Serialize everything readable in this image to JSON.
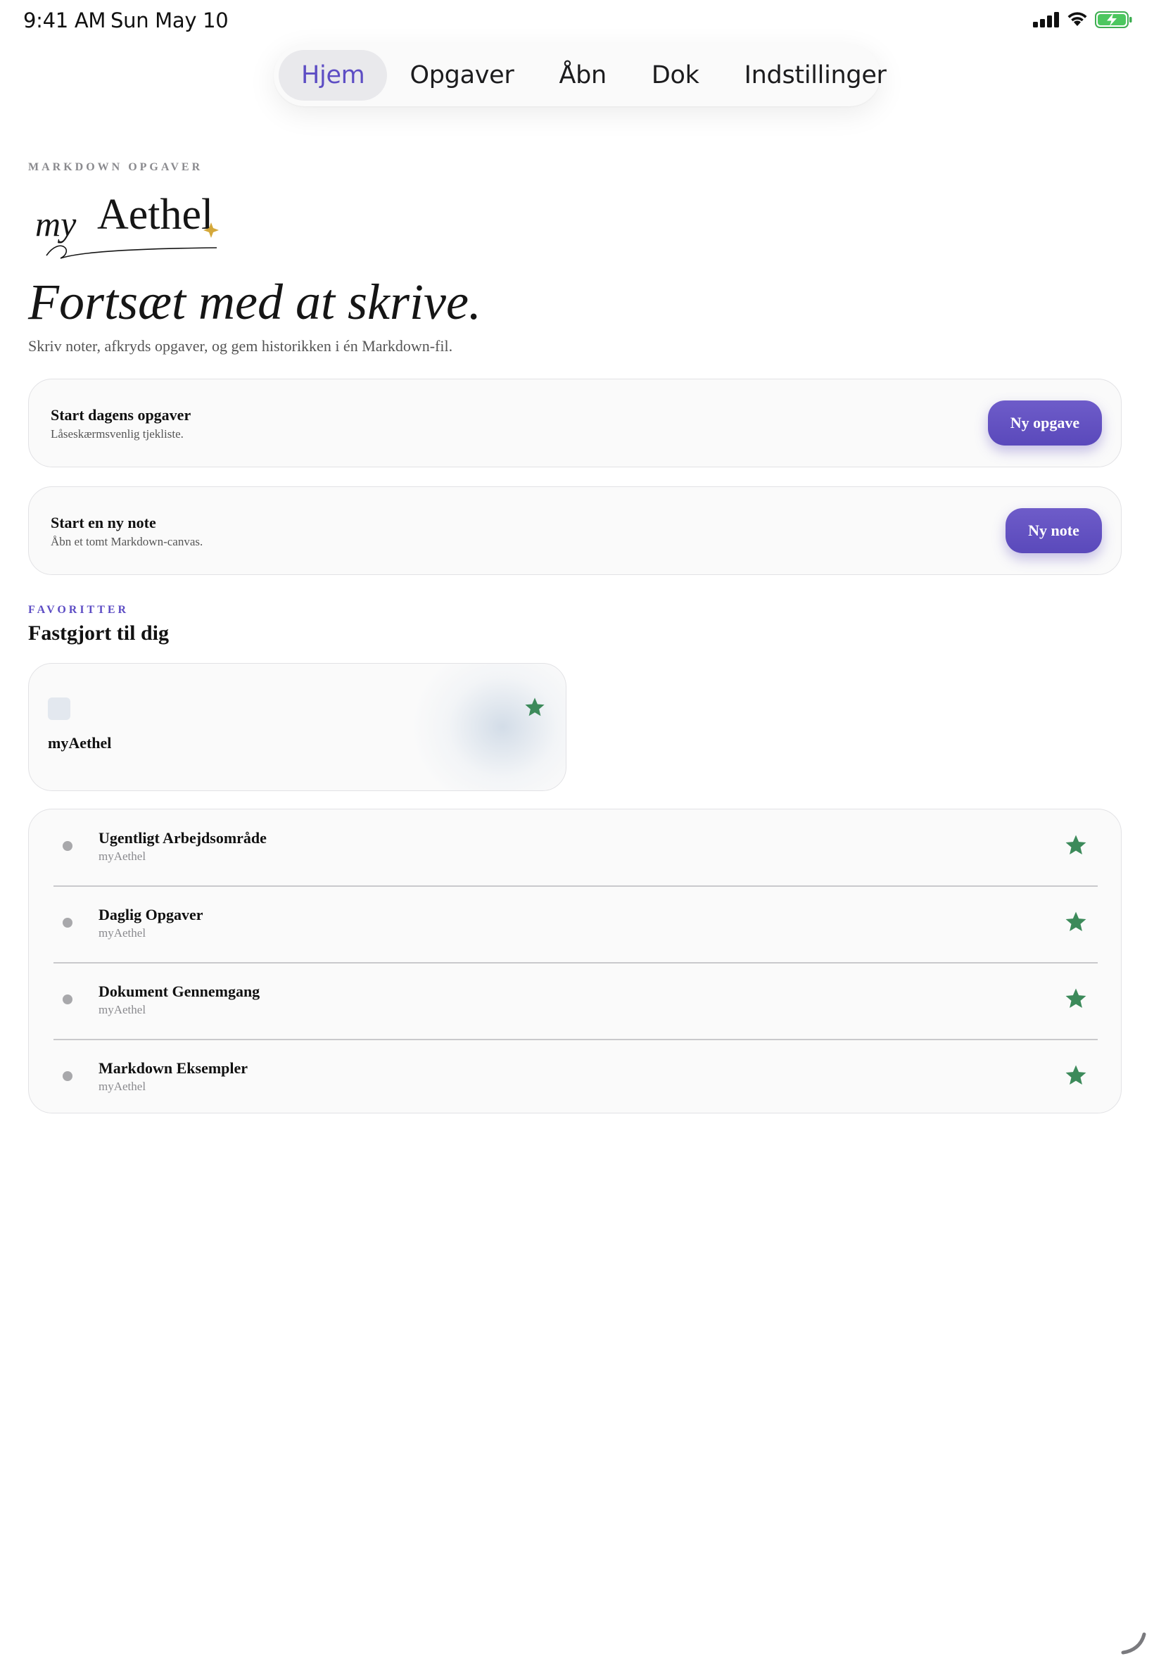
{
  "status_bar": {
    "time": "9:41 AM",
    "date": "Sun May 10"
  },
  "tabs": [
    {
      "label": "Hjem",
      "active": true
    },
    {
      "label": "Opgaver",
      "active": false
    },
    {
      "label": "Åbn",
      "active": false
    },
    {
      "label": "Dok",
      "active": false
    },
    {
      "label": "Indstillinger",
      "active": false
    }
  ],
  "hero": {
    "eyebrow": "MARKDOWN OPGAVER",
    "logo_text": "myAethel",
    "headline": "Fortsæt med at skrive.",
    "subline": "Skriv noter, afkryds opgaver, og gem historikken i én Markdown-fil."
  },
  "actions": [
    {
      "title": "Start dagens opgaver",
      "subtitle": "Låseskærmsvenlig tjekliste.",
      "button": "Ny opgave"
    },
    {
      "title": "Start en ny note",
      "subtitle": "Åbn et tomt Markdown-canvas.",
      "button": "Ny note"
    }
  ],
  "favorites": {
    "eyebrow": "FAVORITTER",
    "title": "Fastgjort til dig",
    "pinned": {
      "label": "myAethel",
      "icon": "star-icon"
    },
    "items": [
      {
        "title": "Ugentligt Arbejdsområde",
        "subtitle": "myAethel"
      },
      {
        "title": "Daglig Opgaver",
        "subtitle": "myAethel"
      },
      {
        "title": "Dokument Gennemgang",
        "subtitle": "myAethel"
      },
      {
        "title": "Markdown Eksempler",
        "subtitle": "myAethel"
      }
    ]
  },
  "colors": {
    "accent": "#5d4dc4",
    "star": "#3c8a5a",
    "logo_spark": "#d4a83a"
  }
}
